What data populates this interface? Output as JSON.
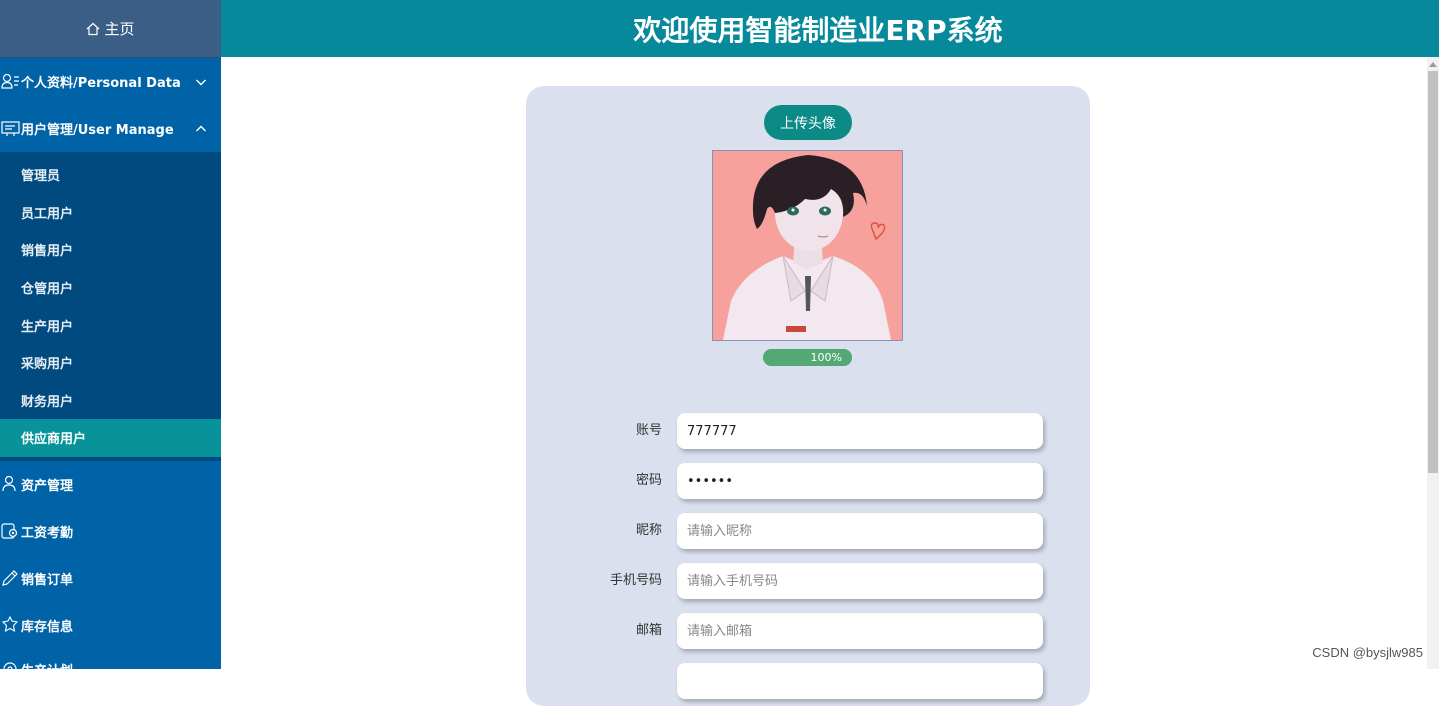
{
  "header": {
    "title": "欢迎使用智能制造业ERP系统"
  },
  "sidebar": {
    "home_label": "主页",
    "menus": [
      {
        "label": "个人资料/Personal Data",
        "icon": "user-profile-icon",
        "expanded": false
      },
      {
        "label": "用户管理/User Manage",
        "icon": "user-manage-icon",
        "expanded": true
      }
    ],
    "sub_items": [
      "管理员",
      "员工用户",
      "销售用户",
      "仓管用户",
      "生产用户",
      "采购用户",
      "财务用户",
      "供应商用户"
    ],
    "active_sub_item": "供应商用户",
    "bottom_menus": [
      {
        "label": "资产管理",
        "icon": "person-icon"
      },
      {
        "label": "工资考勤",
        "icon": "settings-doc-icon"
      },
      {
        "label": "销售订单",
        "icon": "pencil-icon"
      },
      {
        "label": "库存信息",
        "icon": "inventory-icon"
      },
      {
        "label": "生产计划",
        "icon": "gear-icon"
      }
    ]
  },
  "profile": {
    "upload_button": "上传头像",
    "avatar_alt": "avatar",
    "progress_label": "100%",
    "progress": 1.0
  },
  "form": {
    "fields": [
      {
        "label": "账号",
        "value": "777777",
        "placeholder": "",
        "type": "text"
      },
      {
        "label": "密码",
        "value": "••••••",
        "placeholder": "",
        "type": "password"
      },
      {
        "label": "昵称",
        "value": "",
        "placeholder": "请输入昵称",
        "type": "text"
      },
      {
        "label": "手机号码",
        "value": "",
        "placeholder": "请输入手机号码",
        "type": "text"
      },
      {
        "label": "邮箱",
        "value": "",
        "placeholder": "请输入邮箱",
        "type": "text"
      }
    ]
  },
  "watermark": "CSDN @bysjlw985",
  "colors": {
    "sidebar_bg": "#0063a8",
    "submenu_bg": "#004a80",
    "active_item": "#079399",
    "header_bg": "#07899c",
    "card_bg": "#dae0ee",
    "button_bg": "#0b8a86",
    "progress": "#4caf6c"
  }
}
